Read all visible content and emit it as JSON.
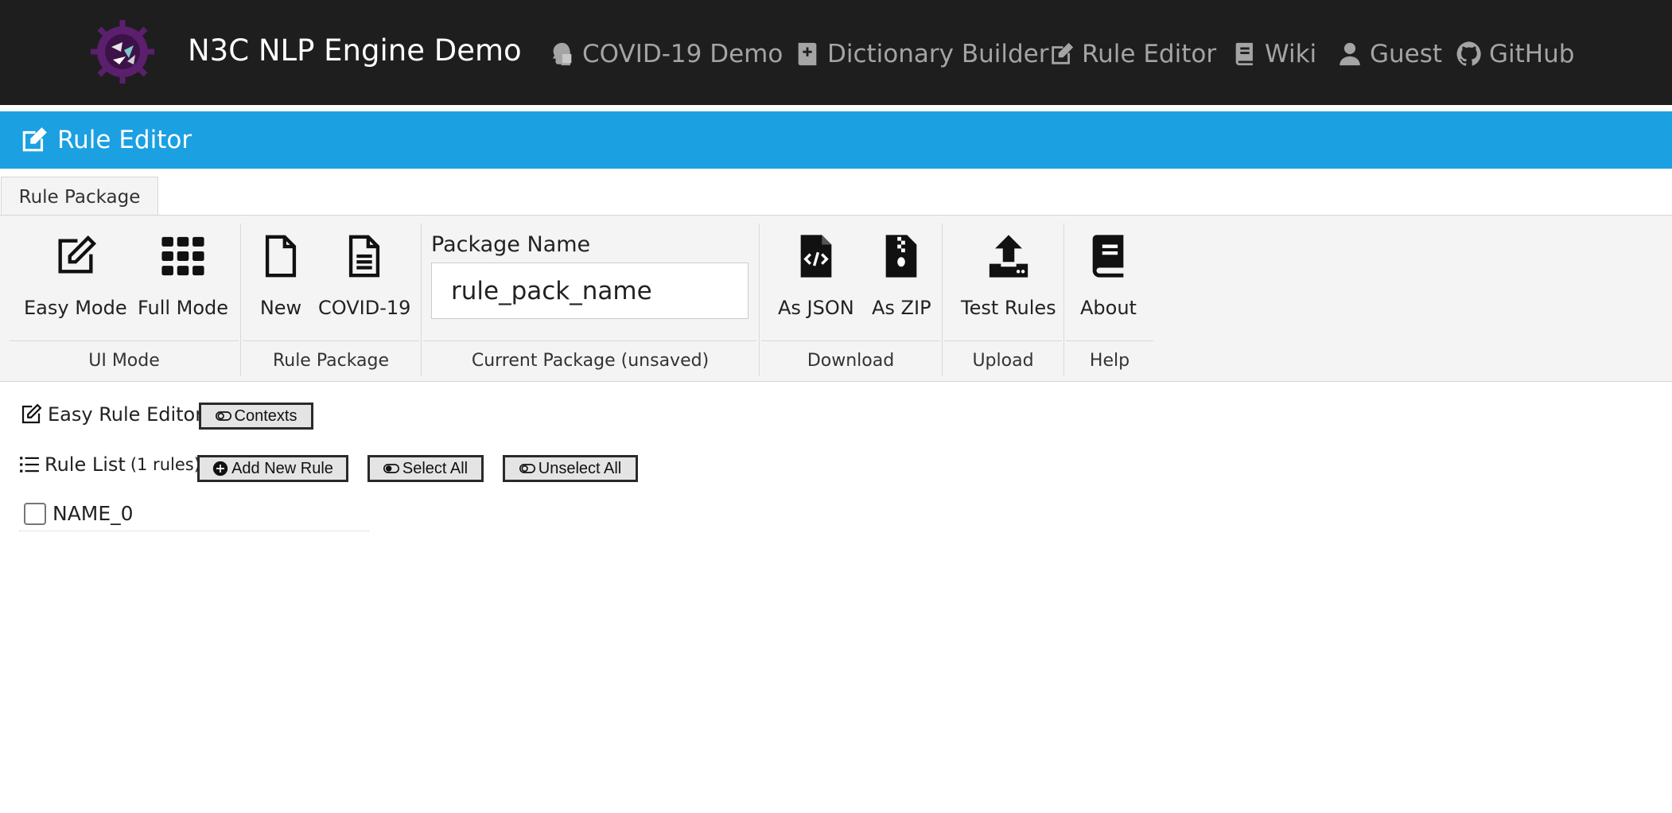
{
  "navbar": {
    "brand": "N3C NLP Engine Demo",
    "links": [
      {
        "label": "COVID-19 Demo",
        "icon": "head-side-mask-icon"
      },
      {
        "label": "Dictionary Builder",
        "icon": "book-plus-icon"
      },
      {
        "label": "Rule Editor",
        "icon": "edit-icon"
      },
      {
        "label": "Wiki",
        "icon": "book-icon"
      },
      {
        "label": "Guest",
        "icon": "user-icon"
      },
      {
        "label": "GitHub",
        "icon": "github-icon"
      }
    ]
  },
  "title_bar": {
    "title": "Rule Editor",
    "icon": "edit-icon"
  },
  "ribbon": {
    "tab": "Rule Package",
    "groups": {
      "ui_mode": {
        "label": "UI Mode",
        "easy": "Easy Mode",
        "full": "Full Mode"
      },
      "rule_package": {
        "label": "Rule Package",
        "new": "New",
        "covid": "COVID-19"
      },
      "current": {
        "label": "Current Package (unsaved)",
        "field_label": "Package Name",
        "value": "rule_pack_name"
      },
      "download": {
        "label": "Download",
        "json": "As JSON",
        "zip": "As ZIP"
      },
      "upload": {
        "label": "Upload",
        "test": "Test Rules"
      },
      "help": {
        "label": "Help",
        "about": "About"
      }
    }
  },
  "editor": {
    "title": "Easy Rule Editor",
    "contexts_button": "Contexts",
    "rule_list": {
      "title": "Rule List",
      "count": "(1 rules)",
      "add_button": "Add New Rule",
      "select_all": "Select All",
      "unselect_all": "Unselect All",
      "rules": [
        {
          "name": "NAME_0"
        }
      ]
    }
  },
  "colors": {
    "navbar_bg": "#1e1e1e",
    "title_bar": "#1ba0e2",
    "ribbon_bg": "#f4f4f4"
  }
}
